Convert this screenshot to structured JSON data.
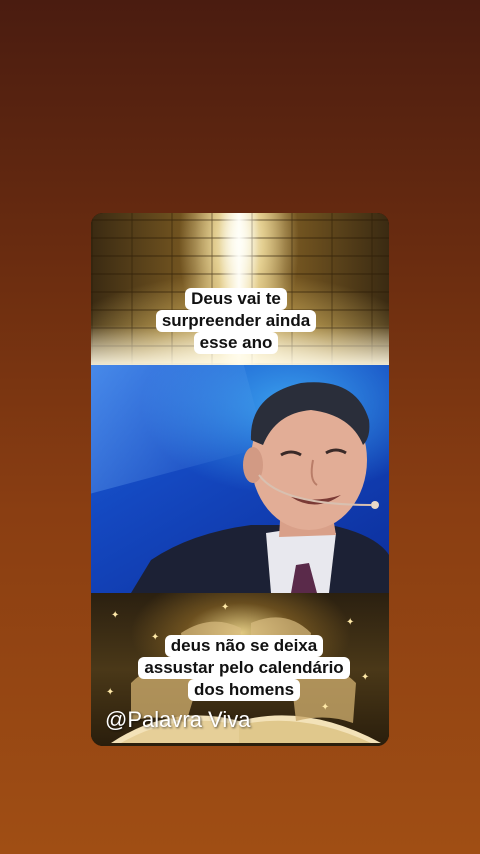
{
  "video": {
    "caption_top": [
      "Deus vai te",
      "surpreender ainda",
      "esse ano"
    ],
    "caption_bottom": [
      "deus não se deixa",
      "assustar pelo calendário",
      "dos homens"
    ],
    "watermark": "@Palavra Viva"
  },
  "colors": {
    "background_top": "#4a1c10",
    "background_bottom": "#a04e14",
    "stage_blue": "#1448c0",
    "caption_bg": "#ffffff"
  }
}
